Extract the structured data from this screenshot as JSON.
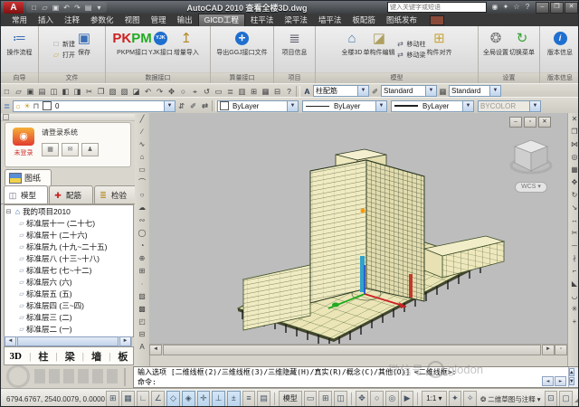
{
  "title_bar": {
    "title": "AutoCAD 2010  查看全楼3D.dwg",
    "search_placeholder": "键入关键字或短语"
  },
  "menu": {
    "tabs": [
      "常用",
      "插入",
      "注释",
      "参数化",
      "视图",
      "管理",
      "输出",
      "GICD工程",
      "柱平法",
      "梁平法",
      "墙平法",
      "板配筋",
      "图纸发布"
    ]
  },
  "ribbon": {
    "g0": {
      "title": "向导",
      "b0": "操作流程"
    },
    "g1": {
      "title": "文件",
      "b0": "新建",
      "b1": "打开",
      "b2": "保存"
    },
    "g2": {
      "title": "数据接口",
      "b0": "PKPM接口",
      "b1": "YJK接口",
      "b2": "增量导入"
    },
    "g3": {
      "title": "算量接口",
      "b0": "导出GGJ接口文件"
    },
    "g4": {
      "title": "项目",
      "b0": "项目信息"
    },
    "g5": {
      "title": "模型",
      "b0": "全楼3D",
      "b1": "单构件编辑",
      "b2": "移动柱",
      "b3": "移动梁",
      "b4": "构件对齐"
    },
    "g6": {
      "title": "设置",
      "b0": "全局设置",
      "b1": "切换菜单"
    },
    "g7": {
      "title": "版本信息",
      "b0": "版本信息"
    }
  },
  "toolbar": {
    "text_style": "柱配筋",
    "dim_style": "Standard",
    "table_style": "Standard",
    "layer": "0",
    "color": "ByLayer",
    "linetype": "ByLayer",
    "lineweight": "ByLayer",
    "plot_style": "BYCOLOR"
  },
  "palette": {
    "login_status": "未登录",
    "login_prompt": "请登录系统",
    "sheet_tab": "图纸",
    "tab_model": "模型",
    "tab_rebar": "配筋",
    "tab_check": "检验",
    "tree_root": "我的项目2010",
    "floors": [
      "标准层十一 (二十七)",
      "标准层十 (二十六)",
      "标准层九 (十九~二十五)",
      "标准层八 (十三~十八)",
      "标准层七 (七~十二)",
      "标准层六 (六)",
      "标准层五 (五)",
      "标准层四 (三~四)",
      "标准层三 (二)",
      "标准层二 (一)"
    ],
    "bt0": "3D",
    "bt1": "柱",
    "bt2": "梁",
    "bt3": "墙",
    "bt4": "板"
  },
  "canvas": {
    "viewcube": "WCS"
  },
  "command": {
    "line1": "输入选项 [二维线框(2)/三维线框(3)/三维隐藏(H)/真实(R)/概念(C)/其他(O)] <二维线框>:",
    "line2": "命令:"
  },
  "status": {
    "coords": "6794.6767, 2540.0079, 0.0000",
    "model": "模型",
    "scale": "1:1",
    "workspace": "二维草图与注释"
  },
  "watermark": {
    "wechat": "微信号",
    "brand": "glodon"
  },
  "icons": {
    "logo": "A",
    "qa": [
      "□",
      "▱",
      "▣",
      "↶",
      "↷",
      "▤"
    ],
    "qadrop": "▾",
    "tr": [
      "◉",
      "✦",
      "☆",
      "?"
    ],
    "win": [
      "–",
      "❐",
      "✕"
    ],
    "std": [
      "□",
      "▱",
      "▣",
      "▤",
      "◫",
      "◧",
      "◨",
      "✂",
      "❐",
      "▨",
      "▧",
      "◪",
      "↶",
      "↷",
      "✥",
      "○",
      "⌖",
      "↺",
      "▭",
      "≣",
      "▥",
      "⊞",
      "▦",
      "⊟",
      "?"
    ],
    "textstyle": "A",
    "dimstyle": "✐",
    "tablestyle": "▦",
    "layer": [
      "≣",
      "☼",
      "☀",
      "⊓",
      "⇵",
      "✐",
      "⇄"
    ],
    "draw": [
      "╱",
      "∕",
      "∿",
      "⌂",
      "▭",
      "⌒",
      "○",
      "☁",
      "∾",
      "◯",
      "◔",
      "⊕",
      "⊞",
      "∙",
      "▨",
      "▩",
      "◰",
      "⊟",
      "A"
    ],
    "mod": [
      "✕",
      "❐",
      "⋈",
      "◎",
      "▦",
      "✥",
      "↻",
      "↘",
      "↔",
      "✂",
      "─",
      "∤",
      "⌐",
      "◣",
      "◡",
      "✳",
      "+"
    ],
    "dwin": [
      "–",
      "▫",
      "✕"
    ],
    "tog": [
      "⊞",
      "▦",
      "∟",
      "∠",
      "◇",
      "◈",
      "✛",
      "⊥",
      "±",
      "≡",
      "▤"
    ],
    "mtool": [
      "▭",
      "⊞",
      "◫"
    ],
    "nav": [
      "✥",
      "○",
      "◎",
      "▶"
    ],
    "ann": [
      "✦",
      "✧"
    ],
    "ws": "❂",
    "lock": "⊡",
    "clean": "▢",
    "gripdots": "◢",
    "expander": "⊟",
    "home": "⌂",
    "floor": "▱",
    "arrow_left": "◄",
    "arrow_right": "►",
    "arrow_up": "▲",
    "arrow_down": "▼",
    "drop": "▼"
  }
}
